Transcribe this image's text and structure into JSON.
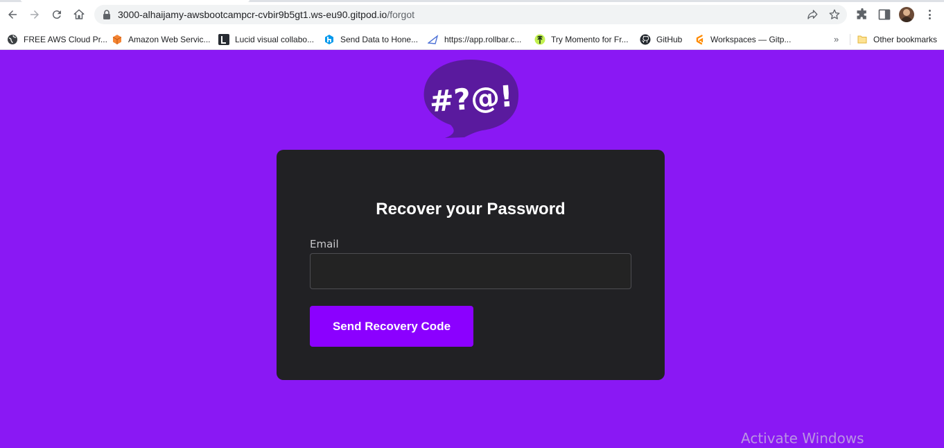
{
  "browser": {
    "url_host": "3000-alhaijamy-awsbootcampcr-cvbir9b5gt1.ws-eu90.gitpod.io",
    "url_path": "/forgot",
    "icons": [
      "back-icon",
      "forward-icon",
      "reload-icon",
      "home-icon",
      "lock-icon",
      "share-icon",
      "star-icon",
      "extensions-icon",
      "side-panel-icon",
      "profile-avatar",
      "menu-icon"
    ]
  },
  "bookmarks": {
    "items": [
      {
        "label": "FREE AWS Cloud Pr...",
        "icon": "globe-icon"
      },
      {
        "label": "Amazon Web Servic...",
        "icon": "aws-cube-icon"
      },
      {
        "label": "Lucid visual collabo...",
        "icon": "lucid-icon"
      },
      {
        "label": "Send Data to Hone...",
        "icon": "honeycomb-icon"
      },
      {
        "label": "https://app.rollbar.c...",
        "icon": "rollbar-icon"
      },
      {
        "label": "Try Momento for Fr...",
        "icon": "momento-icon"
      },
      {
        "label": "GitHub",
        "icon": "github-icon"
      },
      {
        "label": "Workspaces — Gitp...",
        "icon": "gitpod-icon"
      }
    ],
    "overflow": "»",
    "other": "Other bookmarks"
  },
  "page": {
    "logo_text": "#?@!",
    "title": "Recover your Password",
    "email_label": "Email",
    "email_value": "",
    "button_label": "Send Recovery Code"
  },
  "os": {
    "watermark": "Activate Windows"
  },
  "colors": {
    "background": "#8a18f4",
    "card": "#212124",
    "button": "#8b00ff",
    "logo": "#5a1a9e"
  }
}
